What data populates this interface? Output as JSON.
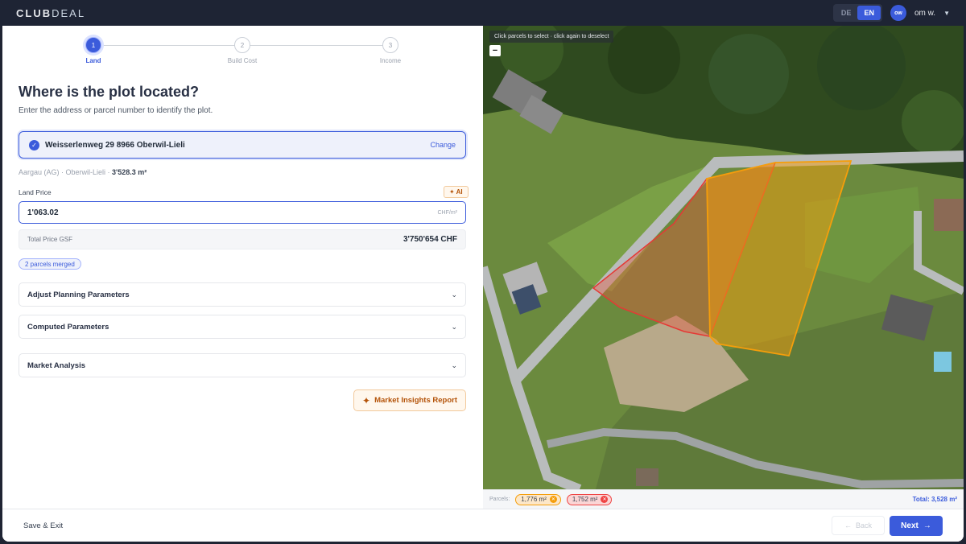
{
  "brand": {
    "part1": "CLUB",
    "part2": "DEAL"
  },
  "lang": {
    "de": "DE",
    "en": "EN"
  },
  "user": {
    "initials": "ow",
    "name": "om w."
  },
  "steps": [
    {
      "num": "1",
      "label": "Land"
    },
    {
      "num": "2",
      "label": "Build Cost"
    },
    {
      "num": "3",
      "label": "Income"
    }
  ],
  "main": {
    "title": "Where is the plot located?",
    "subtitle": "Enter the address or parcel number to identify the plot."
  },
  "address": {
    "value": "Weisserlenweg 29 8966 Oberwil-Lieli",
    "change_label": "Change"
  },
  "meta": {
    "canton": "Aargau (AG)",
    "municipality": "Oberwil-Lieli",
    "area": "3'528.3 m²"
  },
  "land_price": {
    "label": "Land Price",
    "ai_label": "✦ AI",
    "value": "1'063.02",
    "unit": "CHF/m²"
  },
  "total_price": {
    "label": "Total Price GSF",
    "value": "3'750'654 CHF"
  },
  "merged_badge": "2 parcels merged",
  "accordions": [
    "Adjust Planning Parameters",
    "Computed Parameters",
    "Market Analysis"
  ],
  "market_report": {
    "label": "Market Insights Report"
  },
  "map": {
    "hint": "Click parcels to select · click again to deselect",
    "zoom_out": "−"
  },
  "parcels": {
    "label": "Parcels:",
    "items": [
      {
        "area": "1,776 m²",
        "color": "#f59e0b"
      },
      {
        "area": "1,752 m²",
        "color": "#ef4444"
      }
    ],
    "total": "Total: 3,528 m²"
  },
  "footer": {
    "save_exit": "Save & Exit",
    "back": "Back",
    "next": "Next"
  },
  "colors": {
    "accent": "#3b5bdb",
    "topbar": "#1e2434",
    "orange": "#f59e0b",
    "red": "#ef4444"
  }
}
